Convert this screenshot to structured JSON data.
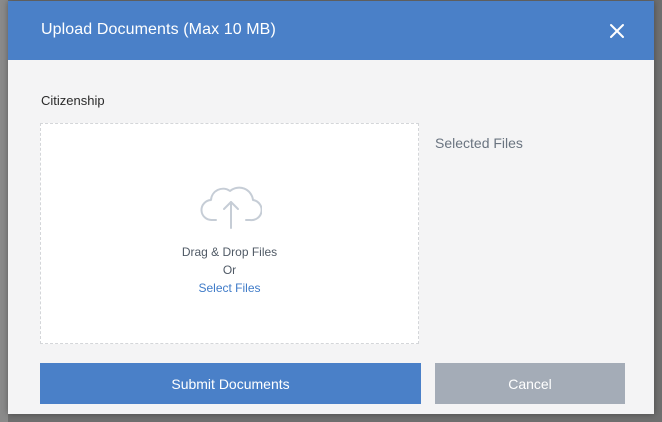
{
  "modal": {
    "title": "Upload Documents (Max 10 MB)",
    "close_icon": "close-icon",
    "field_label": "Citizenship",
    "dropzone": {
      "icon": "cloud-upload-icon",
      "drag_text": "Drag & Drop Files",
      "or_text": "Or",
      "select_link": "Select Files"
    },
    "selected_files_label": "Selected Files",
    "submit_label": "Submit Documents",
    "cancel_label": "Cancel"
  },
  "colors": {
    "primary": "#4a80c8",
    "cancel": "#a4acb7",
    "link": "#3f7bc8",
    "body_bg": "#f4f4f5"
  }
}
